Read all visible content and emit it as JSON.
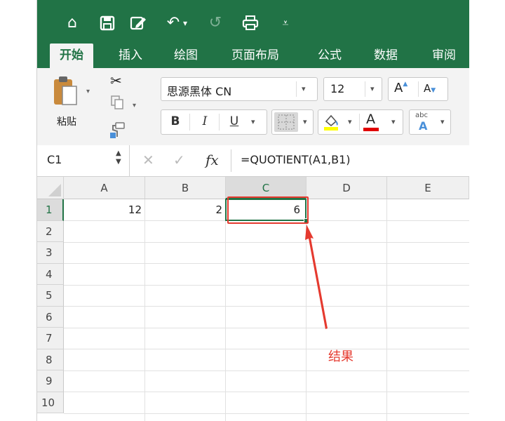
{
  "quick_access": {
    "icons": [
      "home-icon",
      "save-icon",
      "edit-icon",
      "undo-icon",
      "redo-icon",
      "print-icon",
      "customize-icon"
    ],
    "undo_dropdown": "▾"
  },
  "tabs": [
    "开始",
    "插入",
    "绘图",
    "页面布局",
    "公式",
    "数据",
    "审阅"
  ],
  "clipboard": {
    "paste_label": "粘贴"
  },
  "font": {
    "name": "思源黑体 CN",
    "size": "12",
    "bold": "B",
    "italic": "I",
    "underline": "U"
  },
  "name_box": "C1",
  "formula": "=QUOTIENT(A1,B1)",
  "fx": "fx",
  "columns": [
    "A",
    "B",
    "C",
    "D",
    "E"
  ],
  "rows": [
    "1",
    "2",
    "3",
    "4",
    "5",
    "6",
    "7",
    "8",
    "9",
    "10"
  ],
  "cells": {
    "A1": "12",
    "B1": "2",
    "C1": "6"
  },
  "annotation": {
    "text": "结果",
    "color": "#e53a2f"
  },
  "colors": {
    "excel_green": "#217346",
    "highlight_yellow": "#ffff00",
    "font_red": "#e00000"
  }
}
